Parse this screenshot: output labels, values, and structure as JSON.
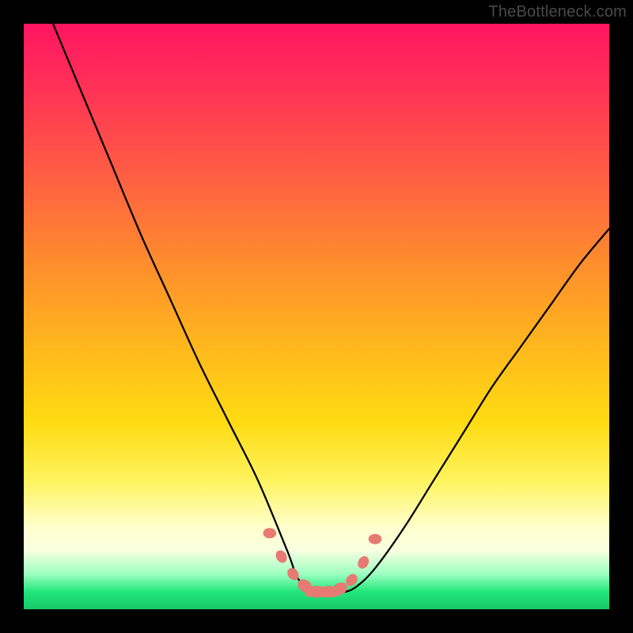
{
  "watermark": "TheBottleneck.com",
  "chart_data": {
    "type": "line",
    "title": "",
    "xlabel": "",
    "ylabel": "",
    "xlim": [
      0,
      100
    ],
    "ylim": [
      0,
      100
    ],
    "series": [
      {
        "name": "bottleneck-curve",
        "x": [
          5,
          10,
          15,
          20,
          25,
          30,
          35,
          40,
          45,
          47,
          50,
          53,
          55,
          57,
          60,
          65,
          70,
          75,
          80,
          85,
          90,
          95,
          100
        ],
        "y": [
          100,
          88,
          76,
          64,
          53,
          42,
          32,
          22,
          10,
          5,
          3,
          3,
          3,
          4,
          7,
          14,
          22,
          30,
          38,
          45,
          52,
          59,
          65
        ]
      }
    ],
    "valley_markers": {
      "name": "valley-points",
      "x": [
        42,
        44,
        46,
        48,
        50,
        52,
        54,
        56,
        58,
        60
      ],
      "y": [
        13,
        9,
        6,
        4,
        3,
        3,
        3.5,
        5,
        8,
        12
      ]
    },
    "background_gradient_stops": [
      {
        "pos": 0,
        "color": "#ff1561"
      },
      {
        "pos": 25,
        "color": "#ff5b44"
      },
      {
        "pos": 55,
        "color": "#ffb71d"
      },
      {
        "pos": 78,
        "color": "#fff35e"
      },
      {
        "pos": 90,
        "color": "#f7ffe0"
      },
      {
        "pos": 97,
        "color": "#22e77a"
      },
      {
        "pos": 100,
        "color": "#18c76a"
      }
    ]
  }
}
